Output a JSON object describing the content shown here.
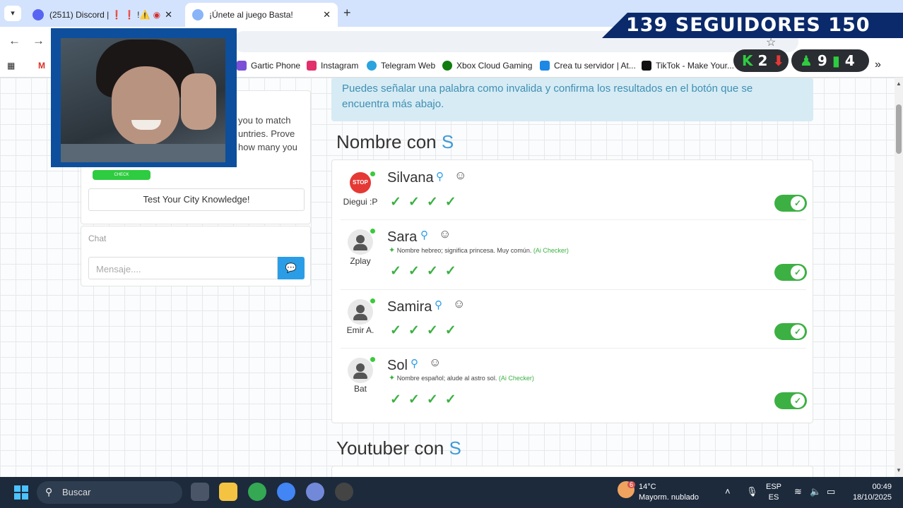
{
  "browser": {
    "tabs": [
      {
        "title": "(2511) Discord | ❗ ❗ !⚠️",
        "favicon": "discord-icon"
      },
      {
        "title": "¡Únete al juego Basta!",
        "favicon": "globe-icon"
      }
    ],
    "new_tab": "+",
    "bookmarks": [
      {
        "label": "Gartic Phone",
        "color": "#7b4fd6"
      },
      {
        "label": "Instagram",
        "color": "#e1306c"
      },
      {
        "label": "Telegram Web",
        "color": "#2aa3df"
      },
      {
        "label": "Xbox Cloud Gaming",
        "color": "#107c10"
      },
      {
        "label": "Crea tu servidor | At...",
        "color": "#1e88e5"
      },
      {
        "label": "TikTok - Make Your...",
        "color": "#111111"
      }
    ],
    "more_bookmarks": "»"
  },
  "overlay": {
    "banner_text": "139  SEGUIDORES  150",
    "stats_left": {
      "k_value": "2",
      "arrow": "⬇"
    },
    "stats_right": {
      "count": "9",
      "bars_value": "4"
    }
  },
  "sidebar": {
    "quiz_lines": [
      "you to match",
      "untries. Prove",
      "how many you"
    ],
    "quiz_pill": "CHECK",
    "quiz_button": "Test Your City Knowledge!",
    "chat_label": "Chat",
    "chat_placeholder": "Mensaje....",
    "send_icon": "💬"
  },
  "main": {
    "info_text": "Puedes señalar una palabra como invalida y confirma los resultados en el botón que se encuentra más abajo.",
    "section1_prefix": "Nombre con ",
    "section1_letter": "S",
    "answers": [
      {
        "word": "Silvana",
        "user": "Diegui :P",
        "avatar": "stop-sign",
        "ai_note": "",
        "ai_checker": "",
        "checks": "✓✓✓✓",
        "valid": true
      },
      {
        "word": "Sara",
        "user": "Zplay",
        "avatar": "default",
        "ai_note": "Nombre hebreo; significa princesa. Muy común.",
        "ai_checker": "(Ai Checker)",
        "checks": "✓✓✓✓",
        "valid": true
      },
      {
        "word": "Samira",
        "user": "Emir A.",
        "avatar": "default",
        "ai_note": "",
        "ai_checker": "",
        "checks": "✓✓✓✓",
        "valid": true
      },
      {
        "word": "Sol",
        "user": "Bat",
        "avatar": "default",
        "ai_note": "Nombre español; alude al astro sol.",
        "ai_checker": "(Ai Checker)",
        "checks": "✓✓✓✓",
        "valid": true
      }
    ],
    "section2_prefix": "Youtuber con ",
    "section2_letter": "S"
  },
  "taskbar": {
    "search_placeholder": "Buscar",
    "weather_temp": "14°C",
    "weather_desc": "Mayorm. nublado",
    "weather_badge": "6",
    "lang_top": "ESP",
    "lang_bottom": "ES",
    "time": "00:49",
    "date": "18/10/2025"
  }
}
